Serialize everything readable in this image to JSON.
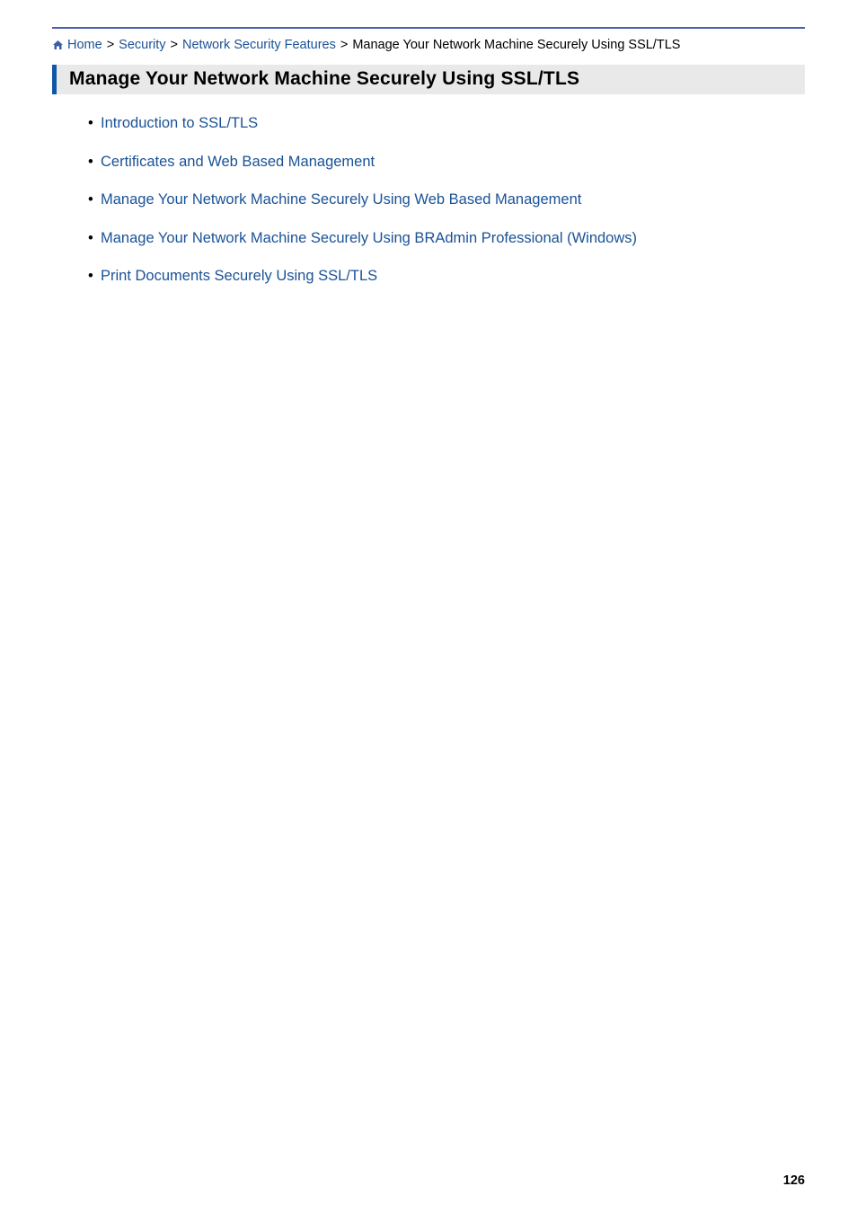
{
  "breadcrumb": {
    "home_label": "Home",
    "items": [
      {
        "label": "Security"
      },
      {
        "label": "Network Security Features"
      }
    ],
    "current": "Manage Your Network Machine Securely Using SSL/TLS",
    "separator": ">"
  },
  "heading": "Manage Your Network Machine Securely Using SSL/TLS",
  "links": [
    {
      "label": "Introduction to SSL/TLS"
    },
    {
      "label": "Certificates and Web Based Management"
    },
    {
      "label": "Manage Your Network Machine Securely Using Web Based Management"
    },
    {
      "label": "Manage Your Network Machine Securely Using BRAdmin Professional (Windows)"
    },
    {
      "label": "Print Documents Securely Using SSL/TLS"
    }
  ],
  "page_number": "126"
}
